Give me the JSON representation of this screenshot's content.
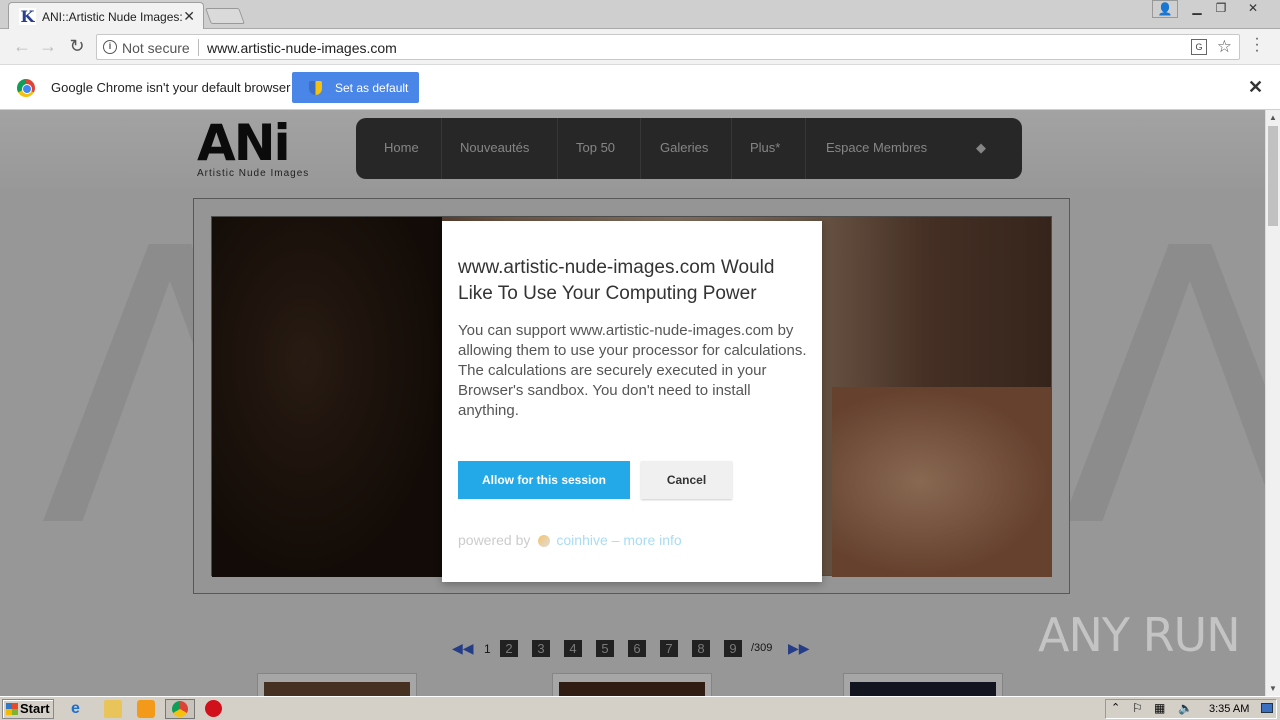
{
  "browser": {
    "tab_title": "ANI::Artistic Nude Images::",
    "tab_favicon": "K",
    "security_label": "Not secure",
    "url": "www.artistic-nude-images.com"
  },
  "infobar": {
    "message": "Google Chrome isn't your default browser",
    "button_label": "Set as default"
  },
  "site": {
    "logo_text": "ANi",
    "logo_subtitle": "Artistic Nude Images",
    "nav": [
      "Home",
      "Nouveautés",
      "Top 50",
      "Galeries",
      "Plus*",
      "Espace Membres"
    ],
    "pager": {
      "current": "1",
      "pages": [
        "2",
        "3",
        "4",
        "5",
        "6",
        "7",
        "8",
        "9"
      ],
      "total": "/309"
    }
  },
  "dialog": {
    "title": "www.artistic-nude-images.com Would Like To Use Your Computing Power",
    "body": "You can support www.artistic-nude-images.com by allowing them to use your processor for calculations. The calculations are securely executed in your Browser's sandbox. You don't need to install anything.",
    "allow_label": "Allow for this session",
    "cancel_label": "Cancel",
    "powered_by": "powered by",
    "brand": "coinhive",
    "more_info": "– more info"
  },
  "watermark": "ANY RUN",
  "taskbar": {
    "start_label": "Start",
    "clock": "3:35 AM"
  },
  "colors": {
    "allow_button": "#23a9e7",
    "set_default_button": "#4a86e8"
  }
}
